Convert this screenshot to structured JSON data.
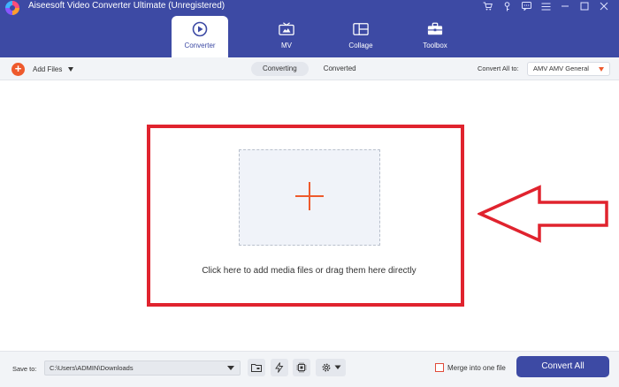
{
  "window": {
    "title": "Aiseesoft Video Converter Ultimate (Unregistered)"
  },
  "nav": {
    "tabs": [
      {
        "label": "Converter",
        "icon": "converter-icon",
        "active": true
      },
      {
        "label": "MV",
        "icon": "tv-icon",
        "active": false
      },
      {
        "label": "Collage",
        "icon": "collage-icon",
        "active": false
      },
      {
        "label": "Toolbox",
        "icon": "toolbox-icon",
        "active": false
      }
    ]
  },
  "toolbar": {
    "add_files_label": "Add Files",
    "segments": [
      "Converting",
      "Converted"
    ],
    "active_segment": "Converting",
    "convert_all_label": "Convert All to:",
    "format_value": "AMV AMV General"
  },
  "main": {
    "drop_text": "Click here to add media files or drag them here directly"
  },
  "bottom": {
    "save_to_label": "Save to:",
    "save_path": "C:\\Users\\ADMIN\\Downloads",
    "merge_label": "Merge into one file",
    "merge_checked": false,
    "convert_button": "Convert All"
  },
  "colors": {
    "header_bg": "#3d4aa4",
    "accent_orange": "#ee5a2d",
    "annotation_red": "#e0232e"
  }
}
